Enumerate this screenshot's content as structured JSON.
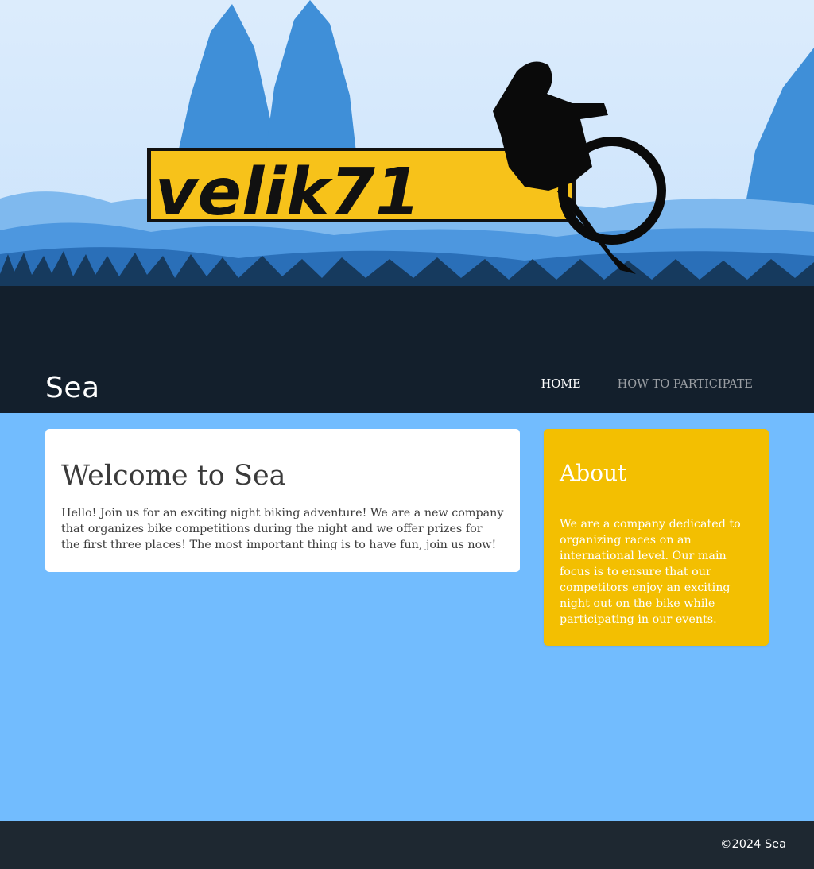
{
  "header": {
    "site_title": "Sea",
    "logo_text": "velik71",
    "nav": [
      {
        "label": "HOME"
      },
      {
        "label": "HOW TO PARTICIPATE"
      }
    ]
  },
  "main": {
    "welcome": {
      "title": "Welcome to Sea",
      "text": "Hello! Join us for an exciting night biking adventure! We are a new company that organizes bike competitions during the night and we offer prizes for the first three places! The most important thing is to have fun, join us now!"
    },
    "about": {
      "title": "About",
      "text": "We are a company dedicated to organizing races on an international level. Our main focus is to ensure that our competitors enjoy an exciting night out on the bike while participating in our events."
    }
  },
  "footer": {
    "copyright": "©2024 Sea"
  },
  "colors": {
    "sky": "#d9ebfc",
    "header_dark": "#131f2c",
    "page_background": "#72bcfe",
    "about_yellow": "#f3bf01",
    "footer_dark": "#1e2831",
    "logo_yellow": "#f7c21a"
  }
}
